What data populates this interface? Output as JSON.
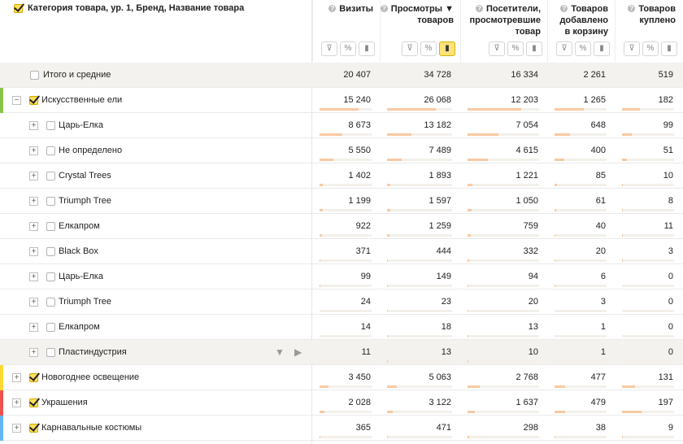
{
  "header": {
    "dimension_title": "Категория товара, ур. 1, Бренд, Название товара",
    "columns": [
      {
        "label_lines": [
          "Визиты"
        ],
        "sorted": false
      },
      {
        "label_lines": [
          "Просмотры ▼",
          "товаров"
        ],
        "sorted": true
      },
      {
        "label_lines": [
          "Посетители,",
          "просмотревшие",
          "товар"
        ],
        "sorted": false
      },
      {
        "label_lines": [
          "Товаров",
          "добавлено",
          "в корзину"
        ],
        "sorted": false
      },
      {
        "label_lines": [
          "Товаров",
          "куплено"
        ],
        "sorted": false
      }
    ],
    "tool_icons": [
      "filter-icon",
      "percent-icon",
      "chart-icon"
    ]
  },
  "total": {
    "label": "Итого и средние",
    "values": [
      "20 407",
      "34 728",
      "16 334",
      "2 261",
      "519"
    ]
  },
  "rows": [
    {
      "label": "Искусственные ели",
      "level": 1,
      "expanded": true,
      "checked": true,
      "color": "#8bc34a",
      "values": [
        "15 240",
        "26 068",
        "12 203",
        "1 265",
        "182"
      ],
      "fractions": [
        0.75,
        0.75,
        0.75,
        0.56,
        0.35
      ]
    },
    {
      "label": "Царь-Елка",
      "level": 2,
      "values": [
        "8 673",
        "13 182",
        "7 054",
        "648",
        "99"
      ],
      "fractions": [
        0.43,
        0.38,
        0.43,
        0.29,
        0.19
      ]
    },
    {
      "label": "Не определено",
      "level": 2,
      "values": [
        "5 550",
        "7 489",
        "4 615",
        "400",
        "51"
      ],
      "fractions": [
        0.27,
        0.22,
        0.28,
        0.18,
        0.1
      ]
    },
    {
      "label": "Crystal Trees",
      "level": 2,
      "values": [
        "1 402",
        "1 893",
        "1 221",
        "85",
        "10"
      ],
      "fractions": [
        0.07,
        0.05,
        0.07,
        0.04,
        0.02
      ]
    },
    {
      "label": "Triumph Tree",
      "level": 2,
      "values": [
        "1 199",
        "1 597",
        "1 050",
        "61",
        "8"
      ],
      "fractions": [
        0.06,
        0.05,
        0.06,
        0.03,
        0.02
      ]
    },
    {
      "label": "Елкапром",
      "level": 2,
      "values": [
        "922",
        "1 259",
        "759",
        "40",
        "11"
      ],
      "fractions": [
        0.05,
        0.04,
        0.05,
        0.02,
        0.02
      ]
    },
    {
      "label": "Black Box",
      "level": 2,
      "values": [
        "371",
        "444",
        "332",
        "20",
        "3"
      ],
      "fractions": [
        0.02,
        0.01,
        0.02,
        0.01,
        0.01
      ]
    },
    {
      "label": "Царь-Елка",
      "level": 2,
      "values": [
        "99",
        "149",
        "94",
        "6",
        "0"
      ],
      "fractions": [
        0.005,
        0.004,
        0.006,
        0.003,
        0
      ]
    },
    {
      "label": "Triumph Tree",
      "level": 2,
      "values": [
        "24",
        "23",
        "20",
        "3",
        "0"
      ],
      "fractions": [
        0.001,
        0.001,
        0.001,
        0.001,
        0
      ]
    },
    {
      "label": "Елкапром",
      "level": 2,
      "values": [
        "14",
        "18",
        "13",
        "1",
        "0"
      ],
      "fractions": [
        0.001,
        0.001,
        0.001,
        0,
        0
      ]
    },
    {
      "label": "Пластиндустрия",
      "level": 2,
      "hovered": true,
      "values": [
        "11",
        "13",
        "10",
        "1",
        "0"
      ],
      "fractions": [
        0.001,
        0.001,
        0.001,
        0,
        0
      ]
    },
    {
      "label": "Новогоднее освещение",
      "level": 1,
      "expanded": false,
      "checked": true,
      "color": "#fdd835",
      "values": [
        "3 450",
        "5 063",
        "2 768",
        "477",
        "131"
      ],
      "fractions": [
        0.17,
        0.15,
        0.17,
        0.21,
        0.25
      ]
    },
    {
      "label": "Украшения",
      "level": 1,
      "expanded": false,
      "checked": true,
      "color": "#ef5350",
      "values": [
        "2 028",
        "3 122",
        "1 637",
        "479",
        "197"
      ],
      "fractions": [
        0.1,
        0.09,
        0.1,
        0.21,
        0.38
      ]
    },
    {
      "label": "Карнавальные костюмы",
      "level": 1,
      "expanded": false,
      "checked": true,
      "color": "#64b5f6",
      "values": [
        "365",
        "471",
        "298",
        "38",
        "9"
      ],
      "fractions": [
        0.02,
        0.01,
        0.02,
        0.02,
        0.02
      ]
    }
  ]
}
